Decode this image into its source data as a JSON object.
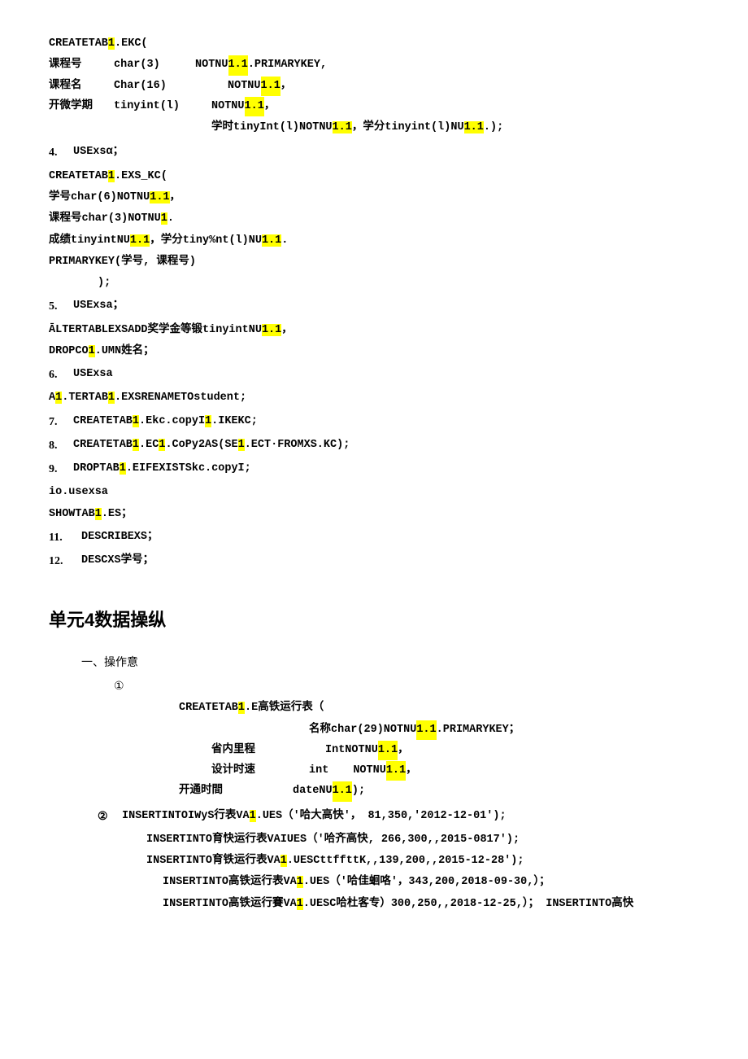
{
  "page": {
    "section_unit4_title": "单元4数据操纵",
    "subsection_ops": "一、操作意",
    "circle1": "①",
    "circle2": "②"
  },
  "lines": {
    "create_tab1_ekc": "CREATETAB",
    "hl1": "1",
    "ekc_part": ".EKC(",
    "field_kechengbuhao": "课程号",
    "char3": "char(3)",
    "notnull_1": "NOTNU",
    "hl_1_1a": "1.1",
    "pk": ".PRIMARYKEY,",
    "field_kechengming": "课程名",
    "Char16": "Char(16)",
    "notnull_2": "NOTNU",
    "hl_1_1b": "1.1",
    "comma1": "，",
    "field_kaixuexueqi": "开微学期",
    "tinyintl": "tinyint(l)",
    "notnull_3": "NOTNU",
    "hl_1_1c": "1.1",
    "comma2": "，",
    "xueshi_line": "学时tinyInt(l)NOTNU",
    "hl_1_1d": "1.1",
    "xueshi_rest": "，学分tinyint(l)NU",
    "hl_1_1e": "1.1",
    "end_paren": ".",
    "item4_use": "USExsα；",
    "create_tab1_exs_kc": "CREATETAB",
    "hl2": "1",
    "exs_kc_part": ".EXS_KC(",
    "xuehao_line": "学号char(6)NOTNU",
    "hl_exs1": "1.1",
    "comma3": "，",
    "kechengbuhao2": "课程号char(3)NOTNU",
    "hl_exs2": "1",
    "period1": ".",
    "chengji_line": "成绩tinyintNU",
    "hl_exs3": "1.1",
    "chengji_rest": "，学分tiny%nt(l)NU",
    "hl_exs4": "1.1",
    "period2": ".",
    "pk2": "PRIMARYKEY(学号, 课程号)",
    "close_paren": ");",
    "item5_use": "USExsa；",
    "alter_line": "ĀLTERTABLEXSADD奖学金等锻tinyintNU",
    "hl_alter": "1.1",
    "alter_rest": "，",
    "drop_line": "DROPCO",
    "hl_drop": "1",
    "drop_rest": ".UMN姓名；",
    "item6_use": "USExsa",
    "a1_line": "A",
    "hl_a1": "1",
    "a1_rest": ".TERTAB",
    "hl_a1b": "1",
    "a1_rest2": ".EXSRENAMETO student;",
    "item7_line": "CREATETAB",
    "hl7": "1",
    "item7_rest": ".Ekc.copyI",
    "hl7b": "1",
    "item7_rest2": ".IKEKC;",
    "item8_line": "CREATETAB",
    "hl8": "1",
    "item8_rest": ".EC",
    "hl8b": "1",
    "item8_rest2": ".CoPy2AS(SE",
    "hl8c": "1",
    "item8_rest3": ".ECT·FROMXS.KC);",
    "item9_line": "DROPTAB",
    "hl9": "1",
    "item9_rest": ".EIFEXISTSkc.copyI;",
    "item_io": "io.usexsa",
    "show_line": "SHOWTAB",
    "hl_show": "1",
    "show_rest": ".ES；",
    "item11_line": "DESCRIBEXS；",
    "item12_line": "DESCXS学号；",
    "create_gaotie": "CREATETAB",
    "hl_gt": "1",
    "gaotie_rest": ".E高铁运行表（",
    "mingcheng_line": "名称char(29)NOTNU",
    "hl_mc": "1.1",
    "mingcheng_rest": ".PRIMARYKEY；",
    "shengneililicheng": "省内里程",
    "IntNotNU": "IntNOTNU",
    "hl_snl": "1.1",
    "comma_snl": "，",
    "shejishisu": "设计时速",
    "int_label": "int",
    "notnu_sjs": "NOTNU",
    "hl_sjs": "1.1",
    "comma_sjs": "，",
    "kaitongshijian": "开通时間",
    "dateNU": "dateNU",
    "hl_ktj": "1.1",
    "end_ktj": ");",
    "insert1": "INSERTINTOIWyS行表VA",
    "hl_ins1": "1",
    "insert1_rest": ".UES（'哈大高快'，  81,350,'2012-12-01');",
    "insert2": "INSERTINTO育快运行表VAIUES（'哈齐高快, 266,300,,2015-0817');",
    "insert3": "INSERTINTO育铁运行表VA",
    "hl_ins3": "1",
    "insert3_rest": ".UESCttffttK,,139,200,,2015-12-28');",
    "insert4": "INSERTINTO高铁运行表VA",
    "hl_ins4": "1",
    "insert4_rest": ".UES（'哈佳蛔咯'，343,200,2018-09-30,）；",
    "insert5": "INSERTINTO高铁运行賽VA",
    "hl_ins5": "1",
    "insert5_rest": ".UESC哈杜客专）300,250,,2018-12-25,）；  INSERTINTO高快"
  }
}
